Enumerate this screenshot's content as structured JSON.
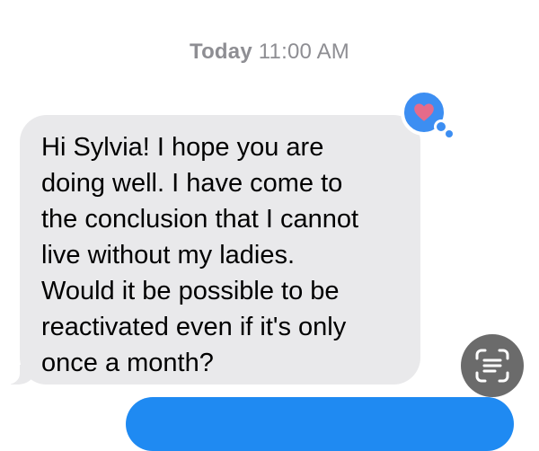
{
  "timestamp": {
    "day": "Today",
    "time": "11:00 AM"
  },
  "incoming_message": {
    "text": "Hi Sylvia! I hope you are\ndoing well. I have come to\nthe conclusion that I cannot\nlive without my ladies.\nWould it be possible to be\nreactivated even if it's only\nonce a month?"
  },
  "reaction": {
    "icon": "heart-icon",
    "bubble_color": "#3c8ef2",
    "heart_color": "#e56b8a"
  },
  "live_text_button": {
    "icon": "live-text-icon"
  },
  "outgoing_message": {
    "bubble_color": "#1f8af2"
  }
}
